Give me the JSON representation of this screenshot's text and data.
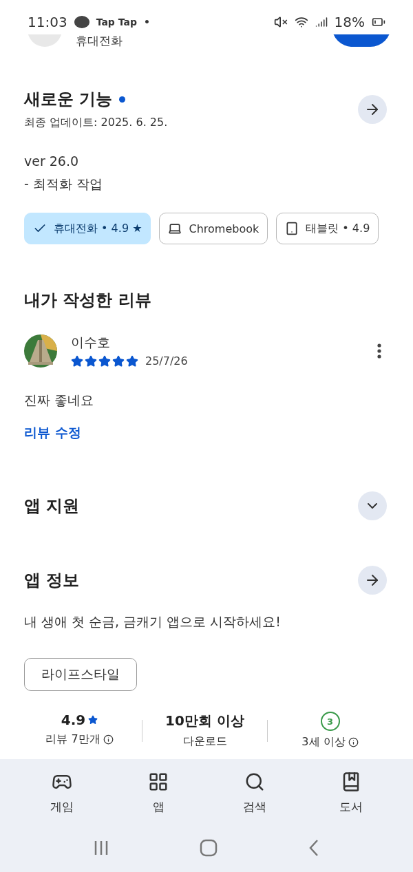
{
  "status_bar": {
    "time": "11:03",
    "notifications": [
      "Tap Tap",
      "•"
    ],
    "battery": "18%"
  },
  "partial_header": {
    "subtitle": "휴대전화"
  },
  "whats_new": {
    "title": "새로운 기능",
    "dot": true,
    "date": "최종 업데이트: 2025. 6. 25.",
    "lines": [
      "ver 26.0",
      "- 최적화 작업"
    ]
  },
  "device_chips": [
    {
      "label": "휴대전화 • 4.9 ★",
      "selected": true
    },
    {
      "kind": "laptop",
      "label": "Chromebook",
      "selected": false
    },
    {
      "kind": "tablet",
      "label": "태블릿 • 4.9",
      "selected": false
    }
  ],
  "my_review": {
    "title": "내가 작성한 리뷰",
    "author": "이수호",
    "stars": 5,
    "date": "25/7/26",
    "text": "진짜 좋네요",
    "edit_link": "리뷰 수정"
  },
  "app_support": {
    "title": "앱 지원",
    "expanded": false
  },
  "app_info": {
    "title": "앱 정보",
    "description": "내 생애 첫 순금, 금캐기 앱으로 시작하세요!",
    "category": "라이프스타일"
  },
  "stats": [
    {
      "kind": "rating",
      "value": "4.9",
      "label": "리뷰 7만개",
      "info": true
    },
    {
      "kind": "text",
      "value": "10만회 이상",
      "label": "다운로드",
      "info": false
    },
    {
      "kind": "age",
      "value": "3",
      "label": "3세 이상",
      "info": true
    }
  ],
  "bottom_nav": [
    {
      "kind": "games",
      "label": "게임",
      "selected": false
    },
    {
      "kind": "apps",
      "label": "앱",
      "selected": false
    },
    {
      "kind": "search",
      "label": "검색",
      "selected": false
    },
    {
      "kind": "books",
      "label": "도서",
      "selected": false
    }
  ]
}
